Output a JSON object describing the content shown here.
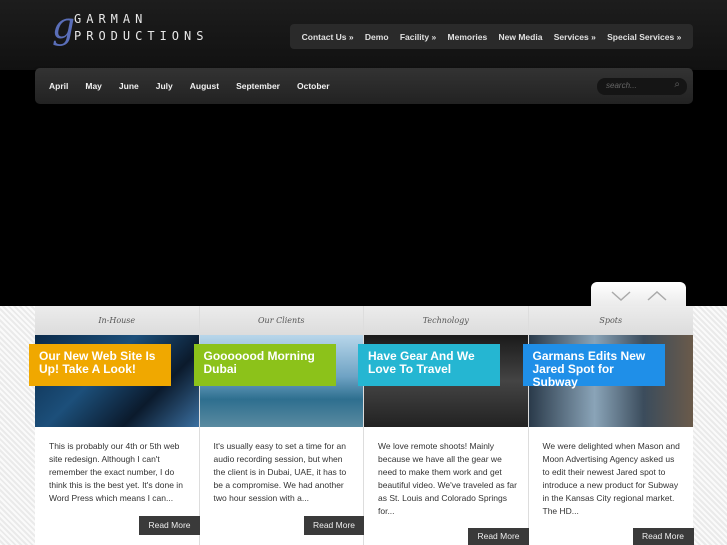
{
  "brand": {
    "mark": "g",
    "line1": "GARMAN",
    "line2": "PRODUCTIONS"
  },
  "top_nav": [
    "Contact Us »",
    "Demo",
    "Facility »",
    "Memories",
    "New Media",
    "Services »",
    "Special Services »"
  ],
  "months": [
    "April",
    "May",
    "June",
    "July",
    "August",
    "September",
    "October"
  ],
  "search": {
    "placeholder": "search..."
  },
  "posts": [
    {
      "category": "In-House",
      "title": "Our New Web Site Is Up! Take A Look!",
      "color": "#f0a800",
      "excerpt": "This is probably our 4th or 5th web site redesign. Although I can't remember the exact number, I do think this is the best yet. It's done in Word Press which means I can...",
      "button": "Read More"
    },
    {
      "category": "Our Clients",
      "title": "Gooooood Morning Dubai",
      "color": "#8cc21a",
      "excerpt": "It's usually easy to set a time for an audio recording session, but when the client is in Dubai, UAE, it has to be a compromise. We had another two hour session with a...",
      "button": "Read More"
    },
    {
      "category": "Technology",
      "title": "Have Gear And We Love To Travel",
      "color": "#25b6d2",
      "excerpt": "We love remote shoots! Mainly because we have all the gear we need to make them work and get beautiful video. We've traveled as far as St. Louis and Colorado Springs for...",
      "button": "Read More"
    },
    {
      "category": "Spots",
      "title": "Garmans Edits New Jared Spot for Subway",
      "color": "#1f8fe8",
      "excerpt": "We were delighted when Mason and Moon Advertising Agency asked us to edit their newest Jared spot to introduce a new product for Subway in the Kansas City regional market. The HD...",
      "button": "Read More"
    }
  ]
}
